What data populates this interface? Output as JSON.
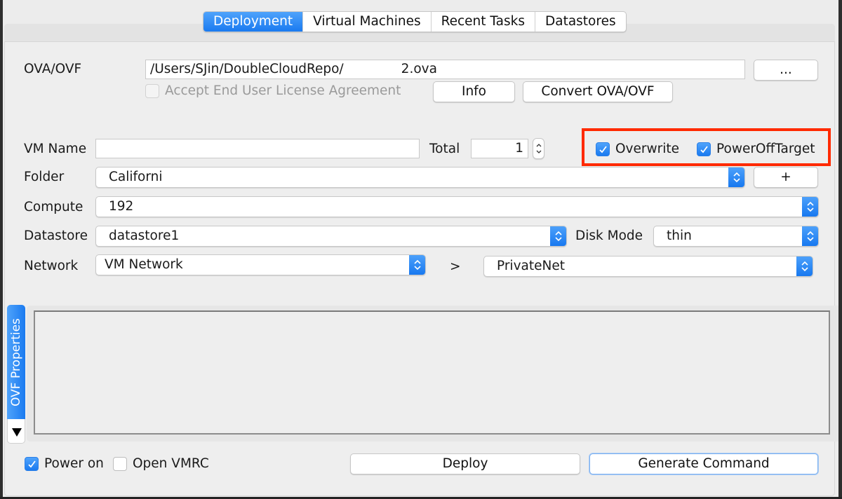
{
  "tabs": [
    {
      "label": "Deployment",
      "active": true
    },
    {
      "label": "Virtual Machines",
      "active": false
    },
    {
      "label": "Recent Tasks",
      "active": false
    },
    {
      "label": "Datastores",
      "active": false
    }
  ],
  "ova": {
    "label": "OVA/OVF",
    "path_prefix": "/Users/SJin/DoubleCloudRepo/",
    "path_suffix": "2.ova",
    "browse_label": "...",
    "eula_label": "Accept End User License Agreement",
    "eula_checked": false,
    "eula_enabled": false,
    "info_label": "Info",
    "convert_label": "Convert OVA/OVF"
  },
  "vm": {
    "name_label": "VM Name",
    "name_value": "",
    "total_label": "Total",
    "total_value": "1",
    "overwrite_label": "Overwrite",
    "overwrite_checked": true,
    "poweroff_label": "PowerOffTarget",
    "poweroff_checked": true
  },
  "folder": {
    "label": "Folder",
    "value": "Californi",
    "add_label": "+"
  },
  "compute": {
    "label": "Compute",
    "value": "192"
  },
  "datastore": {
    "label": "Datastore",
    "value": "datastore1",
    "disk_mode_label": "Disk Mode",
    "disk_mode_value": "thin"
  },
  "network": {
    "label": "Network",
    "source": "VM Network",
    "arrow": ">",
    "target": "PrivateNet"
  },
  "ovf_properties": {
    "tab_label": "OVF Properties",
    "collapse_glyph": "▼"
  },
  "footer": {
    "power_on_label": "Power on",
    "power_on_checked": true,
    "open_vmrc_label": "Open VMRC",
    "open_vmrc_checked": false,
    "deploy_label": "Deploy",
    "generate_label": "Generate Command"
  },
  "colors": {
    "accent": "#1a7af0",
    "highlight_box": "#ff2a00"
  }
}
